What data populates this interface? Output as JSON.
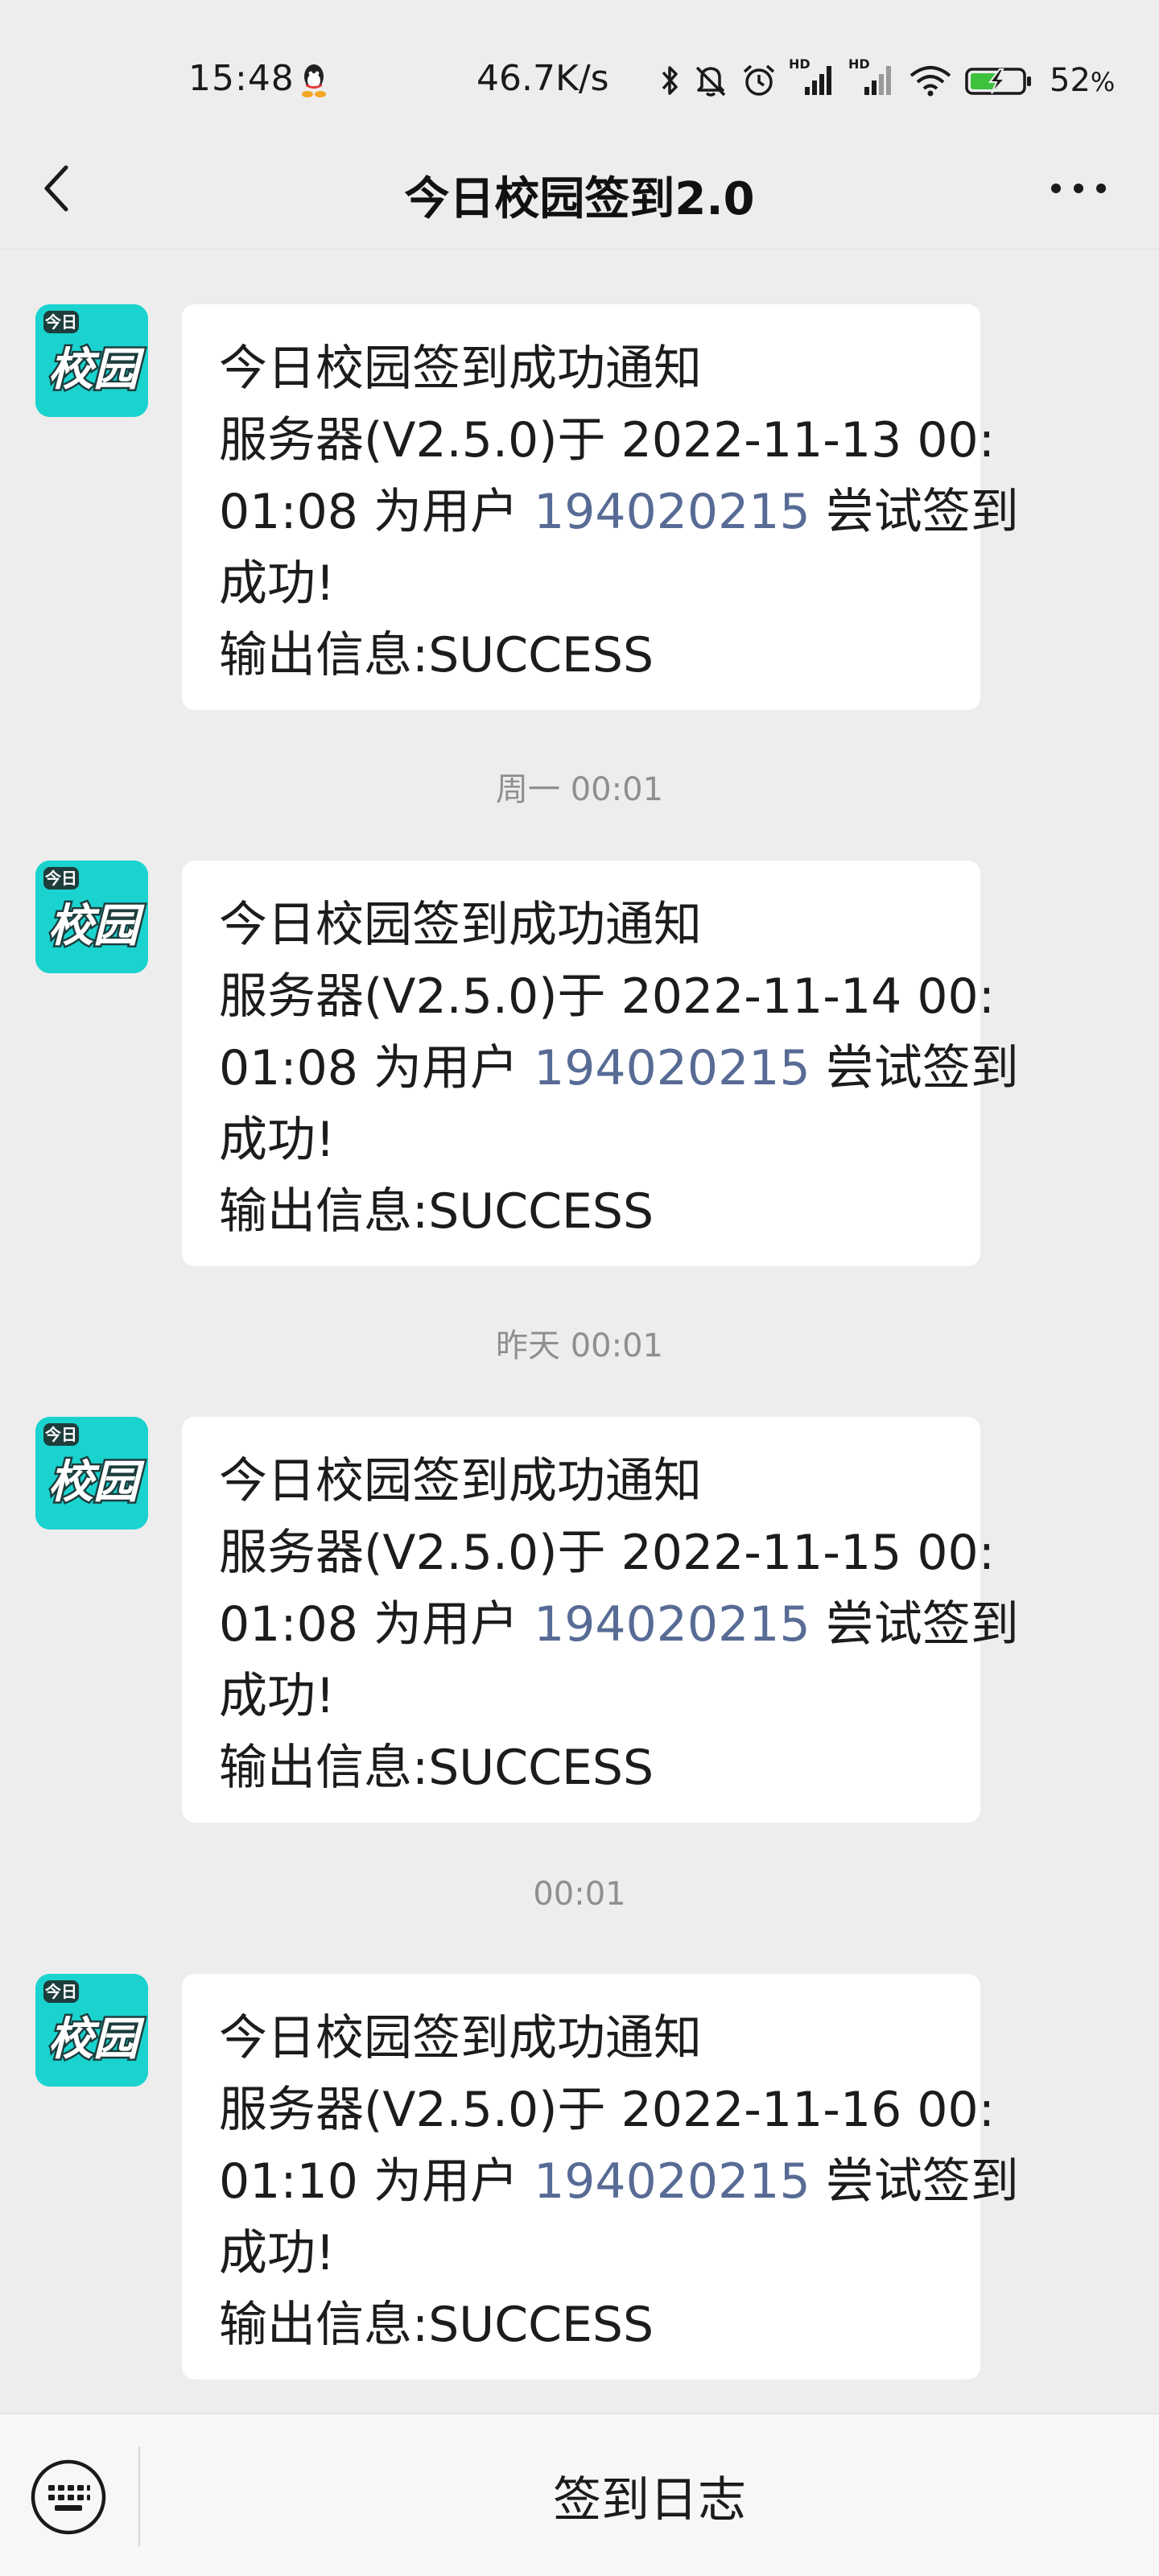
{
  "status_bar": {
    "time": "15:48",
    "net_speed": "46.7K/s",
    "battery_percent": "52",
    "battery_unit": "%",
    "signal_tag_1": "HD",
    "signal_tag_2": "HD",
    "icons": [
      "qq-icon",
      "bluetooth-icon",
      "mute-icon",
      "alarm-icon",
      "signal-hd-icon",
      "signal-hd-icon",
      "wifi-icon",
      "battery-charging-icon"
    ]
  },
  "nav": {
    "title": "今日校园签到2.0",
    "back_icon": "chevron-left-icon",
    "more_icon": "more-dots-icon"
  },
  "avatar": {
    "small_text": "今日",
    "big_text": "校园",
    "color": "#1ad3cf"
  },
  "messages": [
    {
      "title": "今日校园签到成功通知",
      "line2": "服务器(V2.5.0)于 2022-11-13 00:",
      "line3_pre": "01:08 为用户 ",
      "user_id": "194020215",
      "line3_post": " 尝试签到",
      "line4": "成功!",
      "line5": "输出信息:SUCCESS"
    },
    {
      "title": "今日校园签到成功通知",
      "line2": "服务器(V2.5.0)于 2022-11-14 00:",
      "line3_pre": "01:08 为用户 ",
      "user_id": "194020215",
      "line3_post": " 尝试签到",
      "line4": "成功!",
      "line5": "输出信息:SUCCESS"
    },
    {
      "title": "今日校园签到成功通知",
      "line2": "服务器(V2.5.0)于 2022-11-15 00:",
      "line3_pre": "01:08 为用户 ",
      "user_id": "194020215",
      "line3_post": " 尝试签到",
      "line4": "成功!",
      "line5": "输出信息:SUCCESS"
    },
    {
      "title": "今日校园签到成功通知",
      "line2": "服务器(V2.5.0)于 2022-11-16 00:",
      "line3_pre": "01:10 为用户 ",
      "user_id": "194020215",
      "line3_post": " 尝试签到",
      "line4": "成功!",
      "line5": "输出信息:SUCCESS"
    }
  ],
  "timestamps": [
    "周一 00:01",
    "昨天 00:01",
    "00:01"
  ],
  "bottom_bar": {
    "keyboard_icon": "keyboard-icon",
    "menu_label": "签到日志"
  },
  "colors": {
    "background": "#ededed",
    "bubble": "#ffffff",
    "link": "#576b95",
    "timestamp": "#8f8f8f"
  }
}
